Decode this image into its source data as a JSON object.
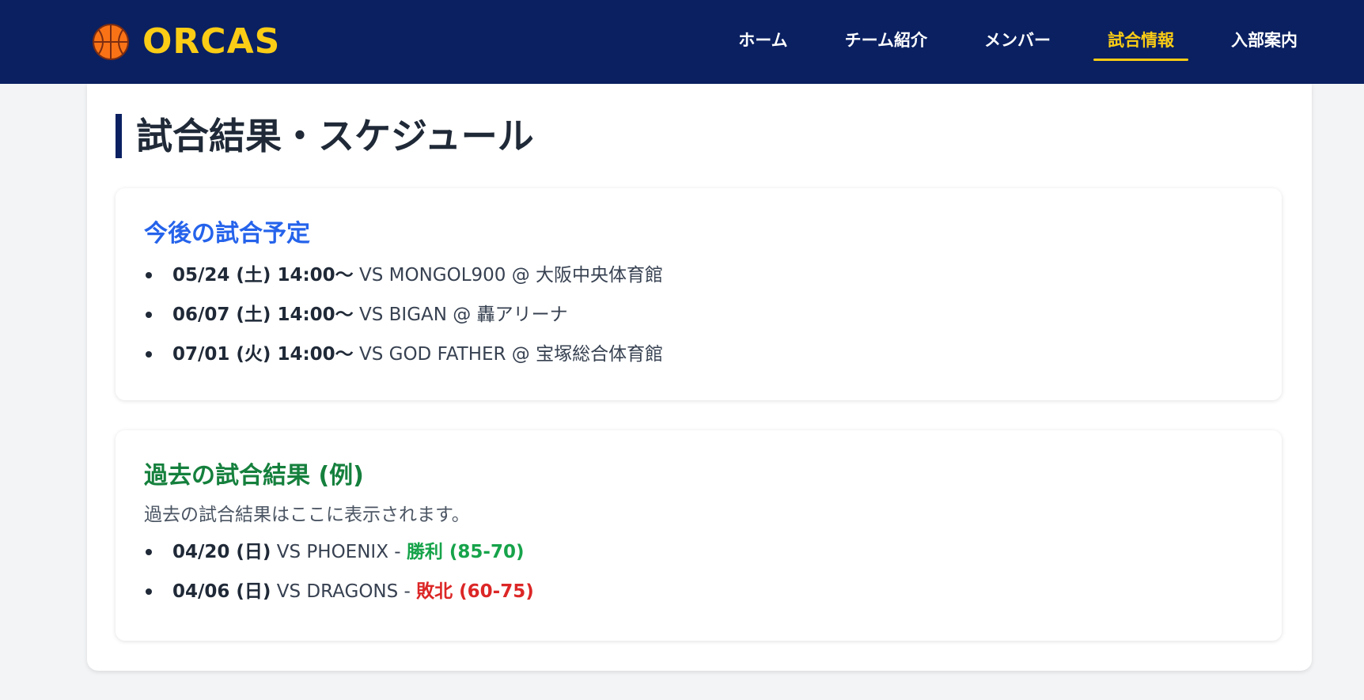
{
  "header": {
    "logo_text": "ORCAS",
    "nav": [
      {
        "label": "ホーム"
      },
      {
        "label": "チーム紹介"
      },
      {
        "label": "メンバー"
      },
      {
        "label": "試合情報",
        "active": true
      },
      {
        "label": "入部案内"
      }
    ]
  },
  "main": {
    "page_title": "試合結果・スケジュール",
    "upcoming": {
      "title": "今後の試合予定",
      "items": [
        {
          "date": "05/24 (土) 14:00〜",
          "detail": "VS MONGOL900 @ 大阪中央体育館"
        },
        {
          "date": "06/07 (土) 14:00〜",
          "detail": "VS BIGAN @ 轟アリーナ"
        },
        {
          "date": "07/01 (火) 14:00〜",
          "detail": "VS GOD FATHER @ 宝塚総合体育館"
        }
      ]
    },
    "past": {
      "title": "過去の試合結果 (例)",
      "description": "過去の試合結果はここに表示されます。",
      "items": [
        {
          "date": "04/20 (日)",
          "detail": "VS PHOENIX -",
          "result": "勝利 (85-70)"
        },
        {
          "date": "04/06 (日)",
          "detail": "VS DRAGONS -",
          "result": "敗北 (60-75)"
        }
      ]
    }
  },
  "colors": {
    "header_bg": "#0a2061",
    "accent_yellow": "#facc15",
    "upcoming_title": "#2563eb",
    "past_title": "#15803d",
    "win": "#16a34a",
    "loss": "#dc2626"
  }
}
